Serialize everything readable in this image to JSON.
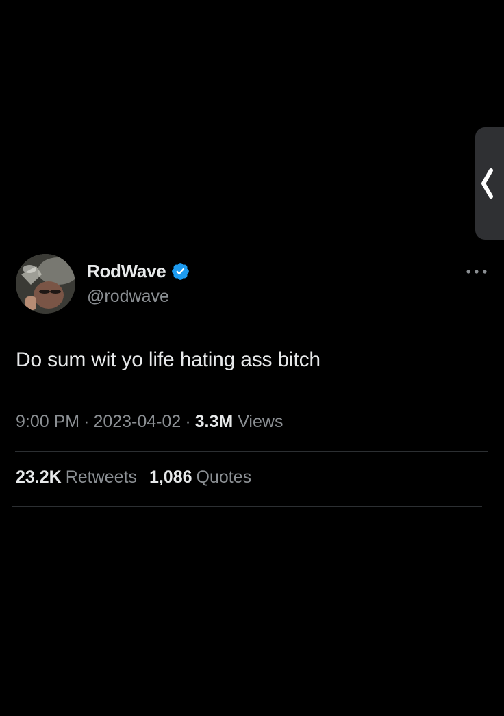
{
  "tweet": {
    "display_name": "RodWave",
    "handle": "@rodwave",
    "text": "Do sum wit yo life hating ass bitch",
    "time": "9:00 PM",
    "date": "2023-04-02",
    "separator": "·",
    "views_count": "3.3M",
    "views_label": "Views",
    "retweets_count": "23.2K",
    "retweets_label": "Retweets",
    "quotes_count": "1,086",
    "quotes_label": "Quotes"
  },
  "icons": {
    "verified": "verified-badge-icon",
    "more": "more-horizontal-icon",
    "side_handle": "chevron-left-icon"
  },
  "colors": {
    "background": "#000000",
    "primary_text": "#e7e9ea",
    "secondary_text": "#8b8f93",
    "verified_blue": "#1d9bf0",
    "divider": "#2c2f32",
    "side_handle": "#2f3033"
  }
}
